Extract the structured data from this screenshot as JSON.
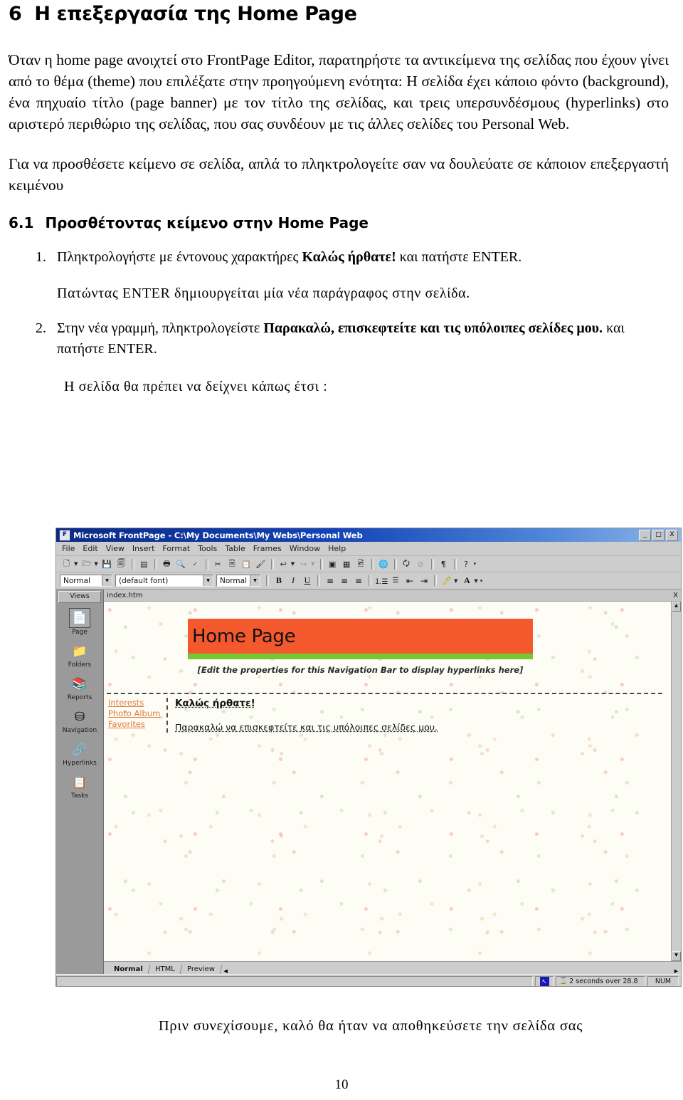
{
  "document": {
    "heading": {
      "number": "6",
      "text": "Η επεξεργασία της Home Page"
    },
    "intro_paragraph": "Όταν η home page ανοιχτεί στο FrontPage Editor, παρατηρήστε τα αντικείμενα της σελίδας που έχουν γίνει από το θέμα (theme) που επιλέξατε στην προηγούμενη ενότητα: Η σελίδα έχει κάποιο φόντο (background), ένα πηχυαίο τίτλο (page banner) με τον τίτλο της σελίδας, και τρεις υπερσυνδέσμους (hyperlinks) στο αριστερό περιθώριο της σελίδας, που σας συνδέουν με τις άλλες σελίδες του Personal Web.",
    "second_paragraph": "Για να προσθέσετε κείμενο σε σελίδα, απλά το πληκτρολογείτε σαν να δουλεύατε σε κάποιον επεξεργαστή κειμένου",
    "subheading": {
      "number": "6.1",
      "text": "Προσθέτοντας κείμενο στην Home Page"
    },
    "steps": [
      {
        "marker": "1.",
        "text_before": "Πληκτρολογήστε με έντονους χαρακτήρες ",
        "bold": "Καλώς ήρθατε!",
        "text_after": " και πατήστε ENTER."
      },
      {
        "marker": "2.",
        "text_before": "Στην νέα γραμμή, πληκτρολογείστε ",
        "bold": "Παρακαλώ, επισκεφτείτε και τις υπόλοιπες σελίδες μου.",
        "text_after": " και πατήστε ENTER."
      }
    ],
    "note_after_step1": "Πατώντας ENTER δημιουργείται μία νέα παράγραφος στην σελίδα.",
    "note_before_image": "Η σελίδα θα πρέπει να δείχνει κάπως έτσι :",
    "closing_line": "Πριν συνεχίσουμε, καλό θα ήταν να αποθηκεύσετε την σελίδα σας",
    "page_number": "10"
  },
  "screenshot": {
    "window": {
      "title": "Microsoft FrontPage - C:\\My Documents\\My Webs\\Personal Web",
      "title_icon": "frontpage-icon",
      "minimize_label": "_",
      "maximize_label": "□",
      "close_label": "X"
    },
    "menubar": [
      "File",
      "Edit",
      "View",
      "Insert",
      "Format",
      "Tools",
      "Table",
      "Frames",
      "Window",
      "Help"
    ],
    "standard_toolbar": [
      {
        "name": "new-page-icon",
        "glyph": "🗋"
      },
      {
        "name": "open-icon",
        "glyph": "🗀"
      },
      {
        "name": "save-icon",
        "glyph": "💾"
      },
      {
        "name": "publish-web-icon",
        "glyph": "🗐"
      },
      {
        "name": "folder-list-icon",
        "glyph": "▤"
      },
      {
        "name": "print-icon",
        "glyph": "🖨"
      },
      {
        "name": "print-preview-icon",
        "glyph": "🔍"
      },
      {
        "name": "spelling-icon",
        "glyph": "ABC"
      },
      {
        "name": "cut-icon",
        "glyph": "✂"
      },
      {
        "name": "copy-icon",
        "glyph": "🗎"
      },
      {
        "name": "paste-icon",
        "glyph": "📋"
      },
      {
        "name": "format-painter-icon",
        "glyph": "🖌"
      },
      {
        "name": "undo-icon",
        "glyph": "↩"
      },
      {
        "name": "redo-icon",
        "glyph": "↪"
      },
      {
        "name": "insert-component-icon",
        "glyph": "▣"
      },
      {
        "name": "insert-table-icon",
        "glyph": "▦"
      },
      {
        "name": "insert-picture-icon",
        "glyph": "🖼"
      },
      {
        "name": "hyperlink-icon",
        "glyph": "🌐"
      },
      {
        "name": "refresh-icon",
        "glyph": "🗘"
      },
      {
        "name": "stop-icon",
        "glyph": "⊘"
      },
      {
        "name": "show-marks-icon",
        "glyph": "¶"
      },
      {
        "name": "help-icon",
        "glyph": "?"
      }
    ],
    "formatting_toolbar": {
      "style_value": "Normal",
      "font_value": "(default font)",
      "size_value": "Normal",
      "buttons": [
        {
          "name": "bold-button",
          "glyph": "B"
        },
        {
          "name": "italic-button",
          "glyph": "I"
        },
        {
          "name": "underline-button",
          "glyph": "U"
        },
        {
          "name": "align-left-button",
          "glyph": "▤"
        },
        {
          "name": "align-center-button",
          "glyph": "▥"
        },
        {
          "name": "align-right-button",
          "glyph": "▤"
        },
        {
          "name": "numbered-list-button",
          "glyph": "⒈"
        },
        {
          "name": "bulleted-list-button",
          "glyph": "☰"
        },
        {
          "name": "decrease-indent-button",
          "glyph": "⇤"
        },
        {
          "name": "increase-indent-button",
          "glyph": "⇥"
        },
        {
          "name": "highlight-button",
          "glyph": "🖊"
        },
        {
          "name": "font-color-button",
          "glyph": "A"
        }
      ]
    },
    "views_pane": {
      "header": "Views",
      "items": [
        {
          "label": "Page",
          "icon": "page-view-icon",
          "glyph": "📄",
          "selected": true
        },
        {
          "label": "Folders",
          "icon": "folders-view-icon",
          "glyph": "📁",
          "selected": false
        },
        {
          "label": "Reports",
          "icon": "reports-view-icon",
          "glyph": "📚",
          "selected": false
        },
        {
          "label": "Navigation",
          "icon": "navigation-view-icon",
          "glyph": "⛁",
          "selected": false
        },
        {
          "label": "Hyperlinks",
          "icon": "hyperlinks-view-icon",
          "glyph": "🔗",
          "selected": false
        },
        {
          "label": "Tasks",
          "icon": "tasks-view-icon",
          "glyph": "📋",
          "selected": false
        }
      ]
    },
    "document_tab": {
      "filename": "index.htm",
      "close_label": "X"
    },
    "page_content": {
      "banner_title": "Home Page",
      "navbar_placeholder": "[Edit the properties for this Navigation Bar to display hyperlinks here]",
      "nav_links": [
        "Interests",
        "Photo Album",
        "Favorites"
      ],
      "greeting": "Καλώς ήρθατε!",
      "body_text": "Παρακαλώ να επισκεφτείτε και τις υπόλοιπες σελίδες μου.",
      "banner_color": "#F4592E",
      "banner_stripe_color": "#76C832",
      "link_color": "#E07A3A"
    },
    "view_tabs": [
      {
        "label": "Normal",
        "active": true
      },
      {
        "label": "HTML",
        "active": false
      },
      {
        "label": "Preview",
        "active": false
      }
    ],
    "statusbar": {
      "download_time": "2 seconds over 28.8",
      "num_lock": "NUM",
      "mouse_icon": "cursor-icon",
      "hourglass_icon": "hourglass-icon"
    }
  }
}
